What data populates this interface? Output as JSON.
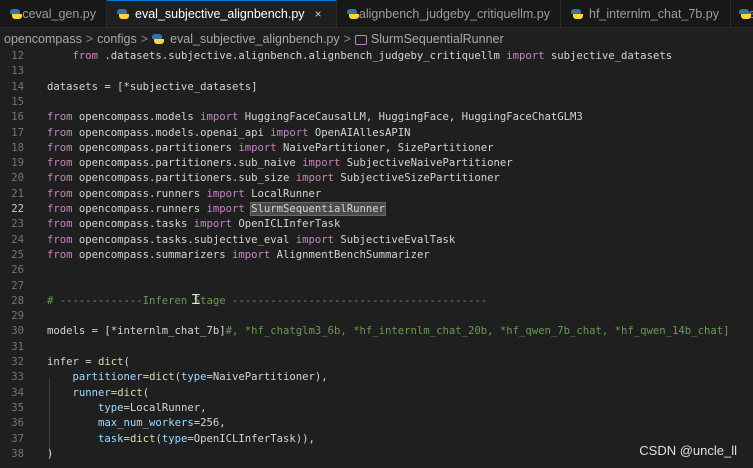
{
  "tabs": [
    {
      "label": "ceval_gen.py",
      "active": false
    },
    {
      "label": "eval_subjective_alignbench.py",
      "active": true
    },
    {
      "label": "alignbench_judgeby_critiquellm.py",
      "active": false
    },
    {
      "label": "hf_internlm_chat_7b.py",
      "active": false
    },
    {
      "label": "te",
      "active": false
    }
  ],
  "close_glyph": "×",
  "breadcrumb": {
    "items": [
      "opencompass",
      "configs",
      "eval_subjective_alignbench.py",
      "SlurmSequentialRunner"
    ],
    "separator": ">"
  },
  "code_lines": [
    {
      "num": "12",
      "text": "    from .datasets.subjective.alignbench.alignbench_judgeby_critiquellm import subjective_datasets"
    },
    {
      "num": "13",
      "text": ""
    },
    {
      "num": "14",
      "text": "datasets = [*subjective_datasets]"
    },
    {
      "num": "15",
      "text": ""
    },
    {
      "num": "16",
      "text": "from opencompass.models import HuggingFaceCausalLM, HuggingFace, HuggingFaceChatGLM3"
    },
    {
      "num": "17",
      "text": "from opencompass.models.openai_api import OpenAIAllesAPIN"
    },
    {
      "num": "18",
      "text": "from opencompass.partitioners import NaivePartitioner, SizePartitioner"
    },
    {
      "num": "19",
      "text": "from opencompass.partitioners.sub_naive import SubjectiveNaivePartitioner"
    },
    {
      "num": "20",
      "text": "from opencompass.partitioners.sub_size import SubjectiveSizePartitioner"
    },
    {
      "num": "21",
      "text": "from opencompass.runners import LocalRunner"
    },
    {
      "num": "22",
      "text": "from opencompass.runners import SlurmSequentialRunner"
    },
    {
      "num": "23",
      "text": "from opencompass.tasks import OpenICLInferTask"
    },
    {
      "num": "24",
      "text": "from opencompass.tasks.subjective_eval import SubjectiveEvalTask"
    },
    {
      "num": "25",
      "text": "from opencompass.summarizers import AlignmentBenchSummarizer"
    },
    {
      "num": "26",
      "text": ""
    },
    {
      "num": "27",
      "text": ""
    },
    {
      "num": "28",
      "text": "# -------------Inferen Stage ----------------------------------------"
    },
    {
      "num": "29",
      "text": ""
    },
    {
      "num": "30",
      "text": "models = [*internlm_chat_7b]#, *hf_chatglm3_6b, *hf_internlm_chat_20b, *hf_qwen_7b_chat, *hf_qwen_14b_chat]"
    },
    {
      "num": "31",
      "text": ""
    },
    {
      "num": "32",
      "text": "infer = dict("
    },
    {
      "num": "33",
      "text": "    partitioner=dict(type=NaivePartitioner),"
    },
    {
      "num": "34",
      "text": "    runner=dict("
    },
    {
      "num": "35",
      "text": "        type=LocalRunner,"
    },
    {
      "num": "36",
      "text": "        max_num_workers=256,"
    },
    {
      "num": "37",
      "text": "        task=dict(type=OpenICLInferTask)),"
    },
    {
      "num": "38",
      "text": ")"
    }
  ],
  "current_line": "22",
  "highlighted_word": "SlurmSequentialRunner",
  "watermark": "CSDN @uncle_ll"
}
